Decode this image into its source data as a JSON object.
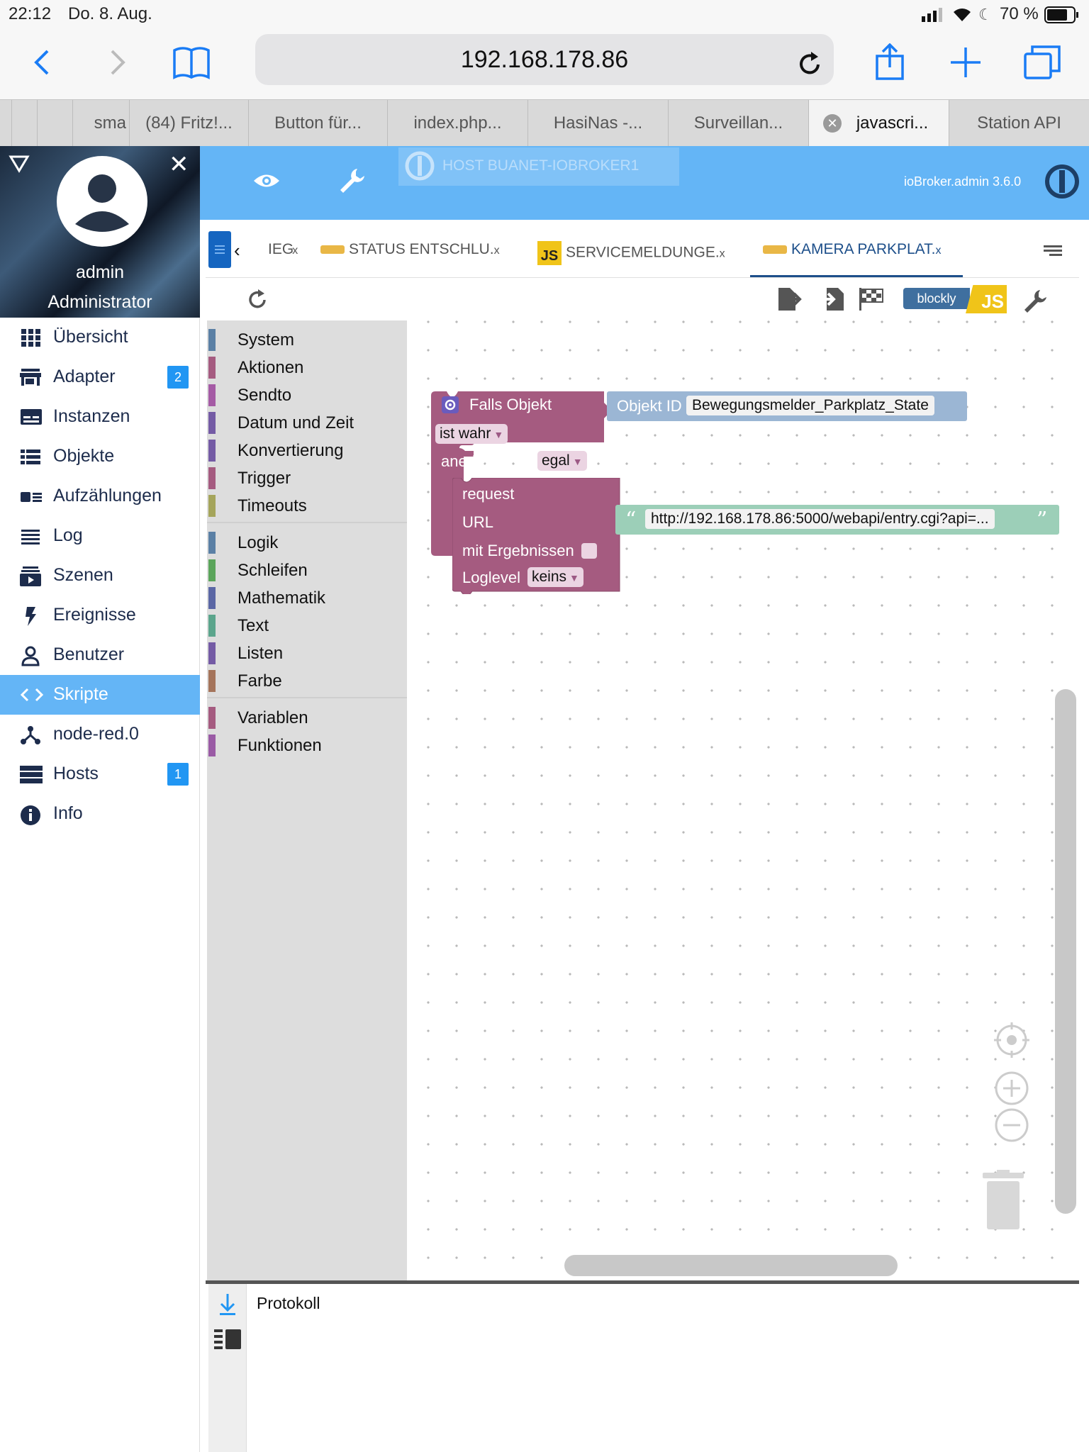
{
  "status_bar": {
    "time": "22:12",
    "date": "Do. 8. Aug.",
    "battery": "70 %"
  },
  "browser": {
    "url": "192.168.178.86",
    "tabs": [
      {
        "label": "sma"
      },
      {
        "label": "(84) Fritz!..."
      },
      {
        "label": "Button für..."
      },
      {
        "label": "index.php..."
      },
      {
        "label": "HasiNas -..."
      },
      {
        "label": "Surveillan..."
      },
      {
        "label": "javascri...",
        "active": true
      },
      {
        "label": "Station API"
      }
    ]
  },
  "user": {
    "name": "admin",
    "role": "Administrator"
  },
  "sidebar": {
    "items": [
      {
        "label": "Übersicht",
        "icon": "apps-icon"
      },
      {
        "label": "Adapter",
        "icon": "store-icon",
        "badge": "2"
      },
      {
        "label": "Instanzen",
        "icon": "instances-icon"
      },
      {
        "label": "Objekte",
        "icon": "list-icon"
      },
      {
        "label": "Aufzählungen",
        "icon": "enum-icon"
      },
      {
        "label": "Log",
        "icon": "log-icon"
      },
      {
        "label": "Szenen",
        "icon": "scenes-icon"
      },
      {
        "label": "Ereignisse",
        "icon": "flash-icon"
      },
      {
        "label": "Benutzer",
        "icon": "user-icon"
      },
      {
        "label": "Skripte",
        "icon": "code-icon",
        "active": true
      },
      {
        "label": "node-red.0",
        "icon": "node-red-icon"
      },
      {
        "label": "Hosts",
        "icon": "hosts-icon",
        "badge": "1"
      },
      {
        "label": "Info",
        "icon": "info-icon"
      }
    ]
  },
  "topbar": {
    "host": "HOST BUANET-IOBROKER1",
    "version": "ioBroker.admin 3.6.0"
  },
  "script_tabs": [
    {
      "label": "IEG"
    },
    {
      "label": "STATUS ENTSCHLU."
    },
    {
      "label": "SERVICEMELDUNGE."
    },
    {
      "label": "KAMERA PARKPLAT.",
      "active": true
    }
  ],
  "editor_toolbar": {
    "blockly_label": "blockly",
    "js_label": "JS"
  },
  "toolbox": {
    "group1": [
      "System",
      "Aktionen",
      "Sendto",
      "Datum und Zeit",
      "Konvertierung",
      "Trigger",
      "Timeouts"
    ],
    "group2": [
      "Logik",
      "Schleifen",
      "Mathematik",
      "Text",
      "Listen",
      "Farbe"
    ],
    "group3": [
      "Variablen",
      "Funktionen"
    ],
    "colors": {
      "System": "#5b80a5",
      "Aktionen": "#a55b80",
      "Sendto": "#a55ba5",
      "Datum und Zeit": "#745ba5",
      "Konvertierung": "#745ba5",
      "Trigger": "#a55b80",
      "Timeouts": "#a5a55b",
      "Logik": "#5b80a5",
      "Schleifen": "#5ba55b",
      "Mathematik": "#5b67a5",
      "Text": "#5ba58c",
      "Listen": "#745ba5",
      "Farbe": "#a5745b",
      "Variablen": "#a55b80",
      "Funktionen": "#9a5ba5"
    }
  },
  "blocks": {
    "trigger_title": "Falls Objekt",
    "object_id_label": "Objekt ID",
    "object_id_value": "Bewegungsmelder_Parkplatz_State",
    "condition": "ist wahr",
    "ack_label": "anerkannt ist",
    "ack_value": "egal",
    "request_label": "request",
    "url_label": "URL",
    "url_value": "http://192.168.178.86:5000/webapi/entry.cgi?api=...",
    "results_label": "mit Ergebnissen",
    "loglevel_label": "Loglevel",
    "loglevel_value": "keins",
    "block_color": "#a55b80"
  },
  "log_panel": {
    "title": "Protokoll"
  }
}
